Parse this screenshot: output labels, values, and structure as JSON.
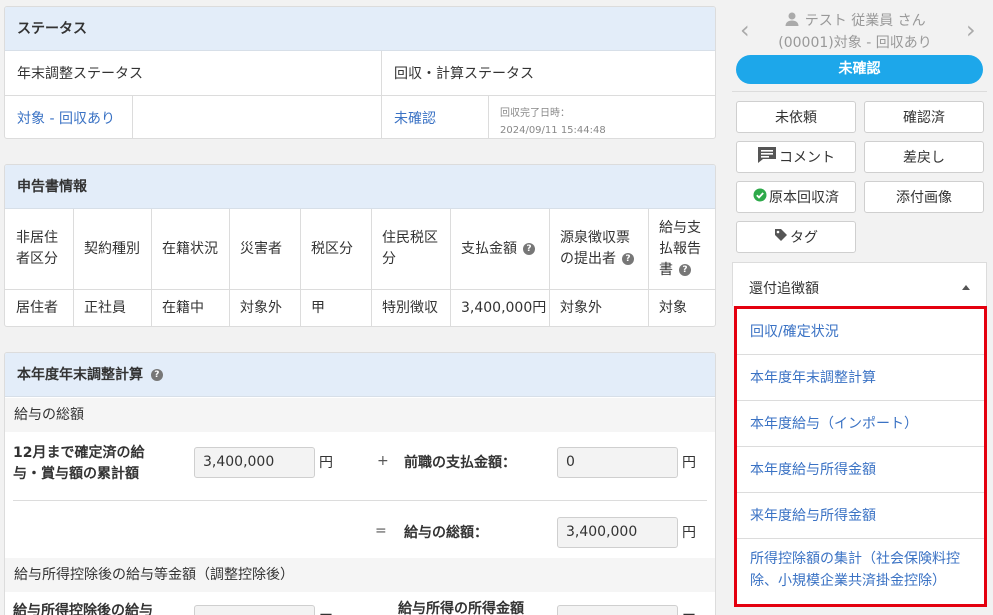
{
  "status_panel": {
    "title": "ステータス",
    "col1_header": "年末調整ステータス",
    "col2_header": "回収・計算ステータス",
    "year_end_status": "対象 - 回収あり",
    "calc_status": "未確認",
    "collected_label": "回収完了日時：",
    "collected_at": "2024/09/11 15:44:48"
  },
  "declaration_panel": {
    "title": "申告書情報",
    "headers": [
      "非居住者区分",
      "契約種別",
      "在籍状況",
      "災害者",
      "税区分",
      "住民税区分",
      "支払金額",
      "源泉徴収票の提出者",
      "給与支払報告書"
    ],
    "header_lines": [
      [
        "非居住",
        "者区分"
      ],
      [
        "契約種別"
      ],
      [
        "在籍状況"
      ],
      [
        "災害者"
      ],
      [
        "税区分"
      ],
      [
        "住民税区",
        "分"
      ],
      [
        "支払金額"
      ],
      [
        "源泉徴収票",
        "の提出者"
      ],
      [
        "給与支",
        "払報告",
        "書"
      ]
    ],
    "values": [
      "居住者",
      "正社員",
      "在籍中",
      "対象外",
      "甲",
      "特別徴収",
      "3,400,000円",
      "対象外",
      "対象"
    ]
  },
  "calc_panel": {
    "title": "本年度年末調整計算",
    "salary_section": "給与の総額",
    "cumulative_label_lines": [
      "12月まで確定済の給",
      "与・賞与額の累計額"
    ],
    "cumulative_value": "3,400,000",
    "plus_sign": "+",
    "prev_job_label": "前職の支払金額：",
    "prev_job_value": "0",
    "equals_sign": "=",
    "total_label": "給与の総額：",
    "total_value": "3,400,000",
    "unit": "円",
    "after_deduction_section": "給与所得控除後の給与等金額（調整控除後）",
    "after_deduction_label": "給与所得控除後の給与",
    "income_amount_label": "給与所得の所得金額",
    "minus_sign": "ー"
  },
  "sidebar": {
    "prev_arrow": "‹",
    "next_arrow": "›",
    "employee_name": "テスト 従業員 さん",
    "employee_code": "(00001)対象 - 回収あり",
    "status": "未確認",
    "buttons": {
      "not_requested": "未依頼",
      "confirmed": "確認済",
      "comment": "コメント",
      "send_back": "差戻し",
      "original_collected": "原本回収済",
      "attached_images": "添付画像",
      "tag": "タグ"
    },
    "dropdown_label": "還付追徴額",
    "menu_items": [
      "回収/確定状況",
      "本年度年末調整計算",
      "本年度給与（インポート）",
      "本年度給与所得金額",
      "来年度給与所得金額",
      "所得控除額の集計（社会保険料控除、小規模企業共済掛金控除）"
    ],
    "menu_item_lines_last": [
      "所得控除額の集計（社会保険料控",
      "除、小規模企業共済掛金控除）"
    ]
  },
  "colors": {
    "accent": "#1da7ea",
    "link": "#3a72c4",
    "highlight_border": "#e4000f",
    "header_bg": "#e3edf9"
  }
}
